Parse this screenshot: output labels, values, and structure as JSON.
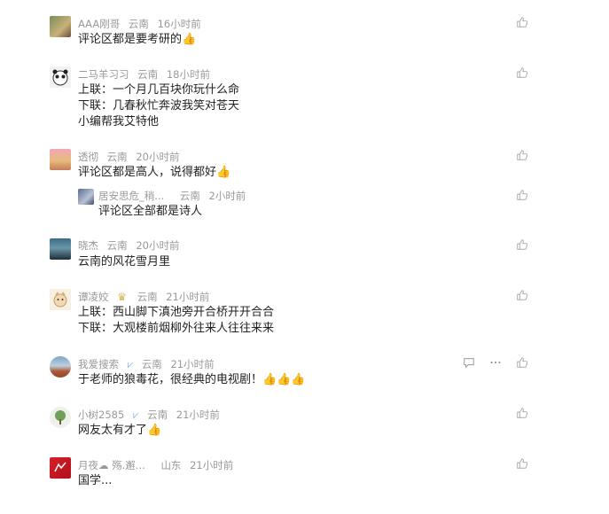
{
  "comments": [
    {
      "user": "AAA刚哥",
      "location": "云南",
      "time": "16小时前",
      "lines": [
        "评论区都是要考研的👍"
      ]
    },
    {
      "user": "二马羊习习",
      "location": "云南",
      "time": "18小时前",
      "lines": [
        "上联：一个月几百块你玩什么命",
        "下联：几春秋忙奔波我笑对苍天",
        "小编帮我艾特他"
      ]
    },
    {
      "user": "透彻",
      "location": "云南",
      "time": "20小时前",
      "lines": [
        "评论区都是高人，说得都好👍"
      ]
    },
    {
      "user": "居安思危_稍...",
      "location": "云南",
      "time": "2小时前",
      "lines": [
        "评论区全部都是诗人"
      ]
    },
    {
      "user": "晓杰",
      "location": "云南",
      "time": "20小时前",
      "lines": [
        "云南的风花雪月里"
      ]
    },
    {
      "user": "谭凌姣",
      "location": "云南",
      "time": "21小时前",
      "lines": [
        "上联：西山脚下滇池旁开合桥开开合合",
        "下联：大观楼前烟柳外往来人往往来来"
      ]
    },
    {
      "user": "我爱搜索",
      "location": "云南",
      "time": "21小时前",
      "lines": [
        "于老师的狼毒花，很经典的电视剧！👍👍👍"
      ]
    },
    {
      "user": "小树2585",
      "location": "云南",
      "time": "21小时前",
      "lines": [
        "网友太有才了👍"
      ]
    },
    {
      "user": "月夜☁ 殇.邂...",
      "location": "山东",
      "time": "21小时前",
      "lines": [
        "国学..."
      ]
    }
  ],
  "icons": {
    "like": "thumbs-up-icon",
    "reply": "comment-icon",
    "more": "more-icon",
    "verified": "verified-icon",
    "crown": "crown-icon"
  },
  "colors": {
    "meta": "#999999",
    "text": "#222222",
    "verified": "#8fb5e8"
  }
}
